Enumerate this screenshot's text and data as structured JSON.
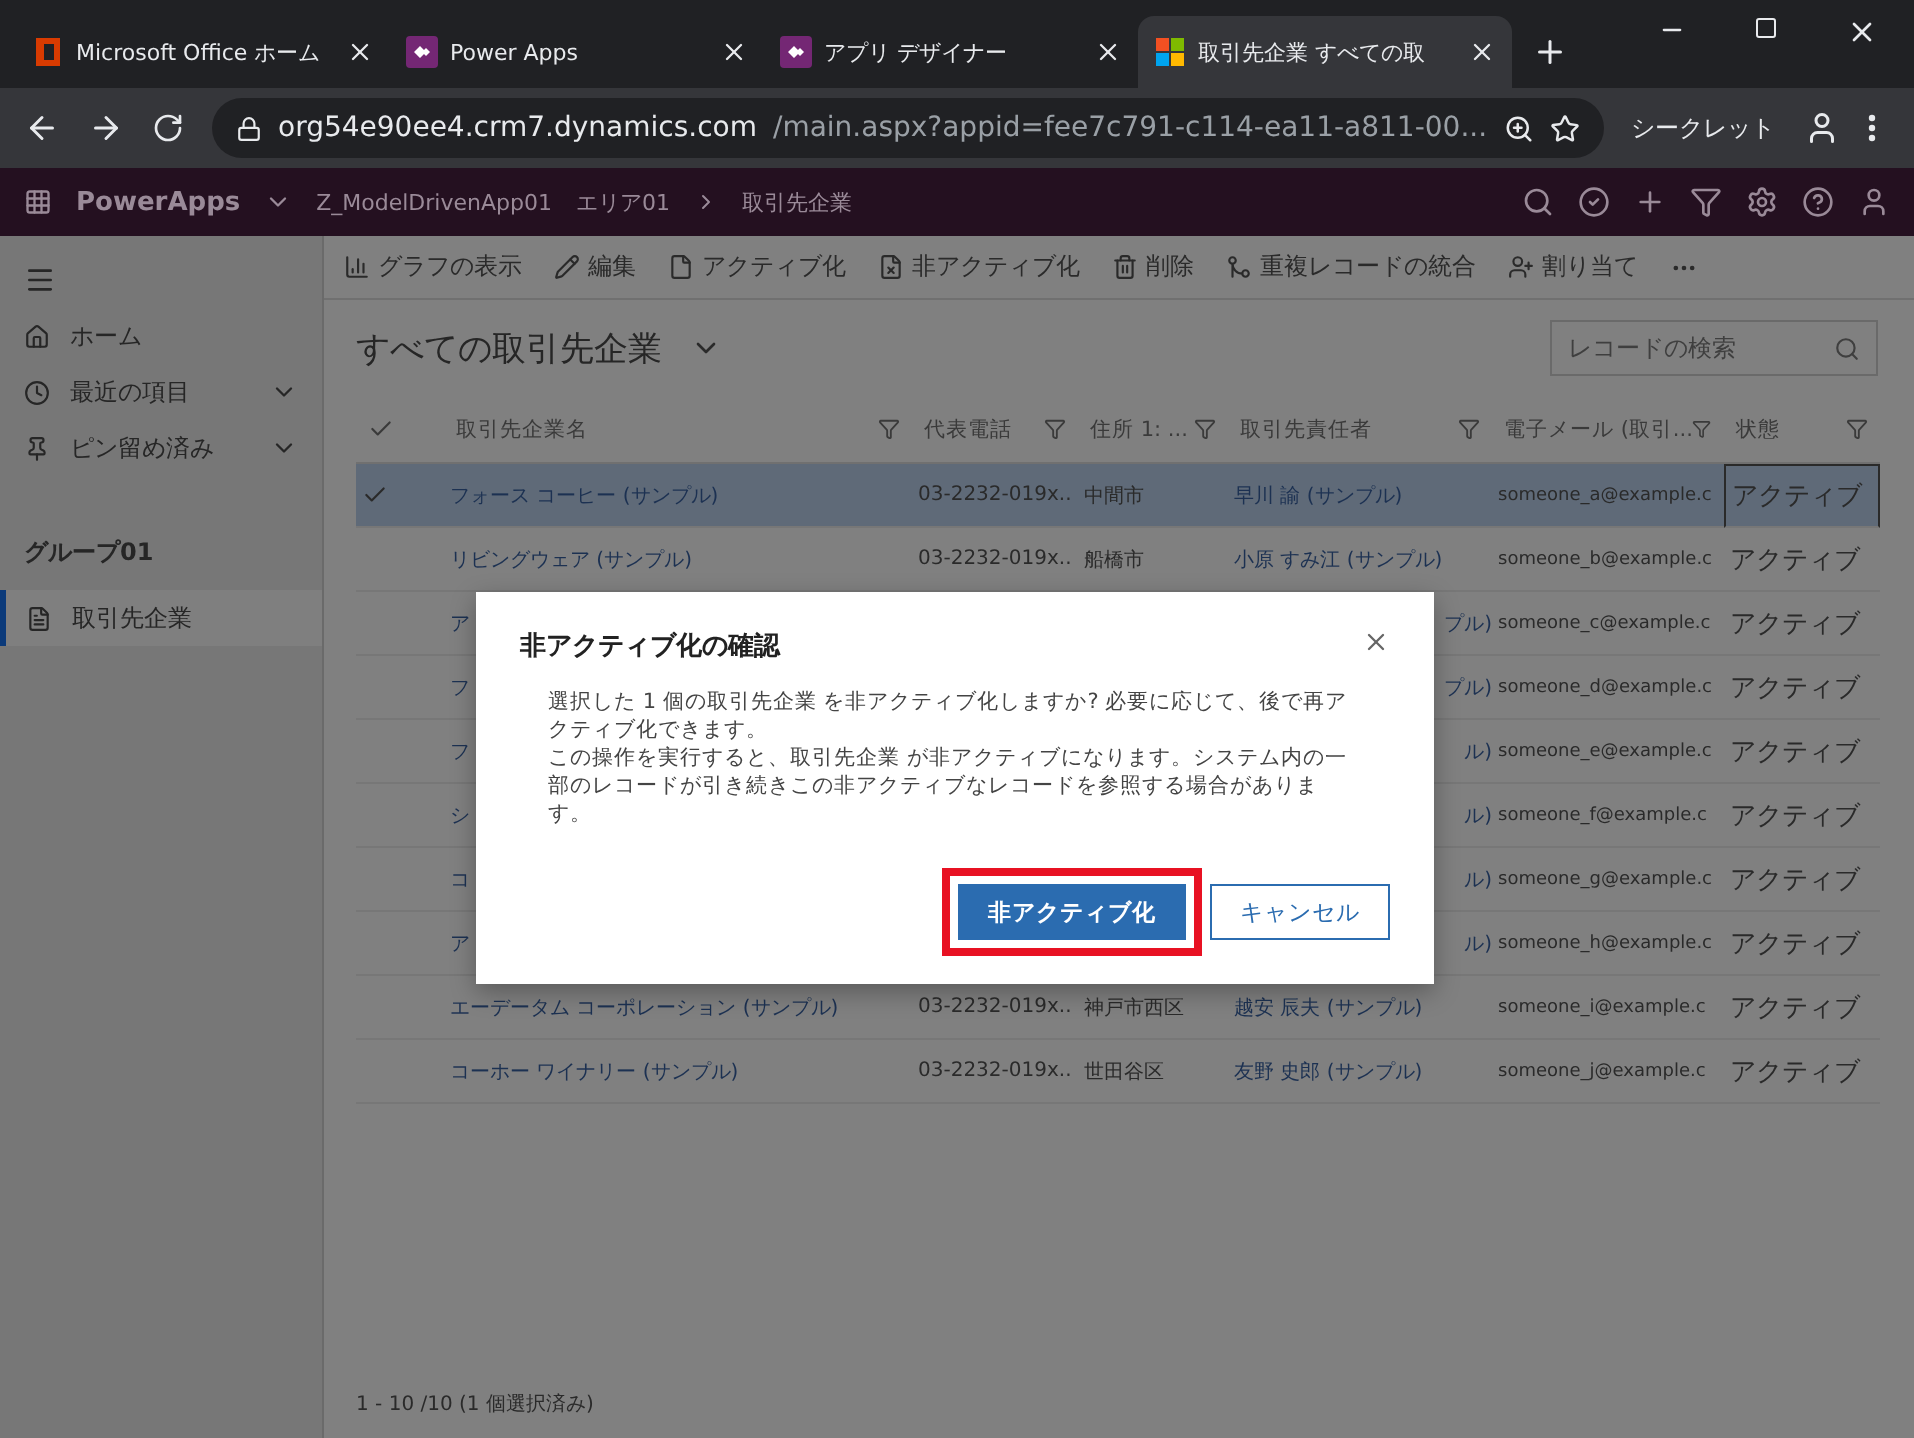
{
  "browser": {
    "tabs": [
      {
        "kind": "office",
        "label": "Microsoft Office ホーム",
        "selected": false
      },
      {
        "kind": "powerapps",
        "label": "Power Apps",
        "selected": false
      },
      {
        "kind": "powerapps",
        "label": "アプリ デザイナー",
        "selected": false
      },
      {
        "kind": "windows",
        "label": "取引先企業 すべての取",
        "selected": true
      }
    ],
    "url_host": "org54e90ee4.crm7.dynamics.com",
    "url_path": "/main.aspx?appid=fee7c791-c114-ea11-a811-00...",
    "profile": "シークレット"
  },
  "header": {
    "brand": "PowerApps",
    "app": "Z_ModelDrivenApp01",
    "breadcrumb": [
      "エリア01",
      "取引先企業"
    ]
  },
  "sidebar": {
    "items": [
      {
        "kind": "home",
        "label": "ホーム"
      },
      {
        "kind": "recent",
        "label": "最近の項目"
      },
      {
        "kind": "pinned",
        "label": "ピン留め済み"
      }
    ],
    "group": "グループ01",
    "entities": [
      {
        "label": "取引先企業",
        "selected": true
      }
    ]
  },
  "commands": [
    {
      "kind": "chart",
      "label": "グラフの表示"
    },
    {
      "kind": "edit",
      "label": "編集"
    },
    {
      "kind": "activate",
      "label": "アクティブ化"
    },
    {
      "kind": "deactivate",
      "label": "非アクティブ化"
    },
    {
      "kind": "delete",
      "label": "削除"
    },
    {
      "kind": "merge",
      "label": "重複レコードの統合"
    },
    {
      "kind": "assign",
      "label": "割り当て"
    }
  ],
  "view": {
    "title": "すべての取引先企業",
    "search_placeholder": "レコードの検索"
  },
  "table": {
    "columns": [
      "取引先企業名",
      "代表電話",
      "住所 1: ...",
      "取引先責任者",
      "電子メール (取引...",
      "状態"
    ],
    "rows": [
      {
        "selected": true,
        "cells": [
          "フォース コーヒー (サンプル)",
          "03-2232-019x..",
          "中間市",
          "早川 諭 (サンプル)",
          "someone_a@example.c",
          "アクティブ"
        ]
      },
      {
        "selected": false,
        "cells": [
          "リビングウェア (サンプル)",
          "03-2232-019x..",
          "船橋市",
          "小原 すみ江 (サンプル)",
          "someone_b@example.c",
          "アクティブ"
        ]
      },
      {
        "selected": false,
        "cells": [
          "ア",
          null,
          null,
          "プル)",
          "someone_c@example.c",
          "アクティブ"
        ]
      },
      {
        "selected": false,
        "cells": [
          "フ",
          null,
          null,
          "プル)",
          "someone_d@example.c",
          "アクティブ"
        ]
      },
      {
        "selected": false,
        "cells": [
          "フ",
          null,
          null,
          "ル)",
          "someone_e@example.c",
          "アクティブ"
        ]
      },
      {
        "selected": false,
        "cells": [
          "シ",
          null,
          null,
          "ル)",
          "someone_f@example.c",
          "アクティブ"
        ]
      },
      {
        "selected": false,
        "cells": [
          "コ",
          null,
          null,
          "ル)",
          "someone_g@example.c",
          "アクティブ"
        ]
      },
      {
        "selected": false,
        "cells": [
          "ア",
          null,
          null,
          "ル)",
          "someone_h@example.c",
          "アクティブ"
        ]
      },
      {
        "selected": false,
        "cells": [
          "エーデータム コーポレーション (サンプル)",
          "03-2232-019x..",
          "神戸市西区",
          "越安 辰夫 (サンプル)",
          "someone_i@example.c",
          "アクティブ"
        ]
      },
      {
        "selected": false,
        "cells": [
          "コーホー ワイナリー (サンプル)",
          "03-2232-019x..",
          "世田谷区",
          "友野 史郎 (サンプル)",
          "someone_j@example.c",
          "アクティブ"
        ]
      }
    ],
    "footer": "1 - 10 /10 (1 個選択済み)"
  },
  "dialog": {
    "title": "非アクティブ化の確認",
    "paragraphs": [
      "選択した 1 個の取引先企業 を非アクティブ化しますか? 必要に応じて、後で再アクティブ化できます。",
      "この操作を実行すると、取引先企業 が非アクティブになります。システム内の一部のレコードが引き続きこの非アクティブなレコードを参照する場合があります。"
    ],
    "buttons": [
      {
        "kind": "primary",
        "label": "非アクティブ化",
        "highlighted": true
      },
      {
        "kind": "secondary",
        "label": "キャンセル",
        "highlighted": false
      }
    ]
  }
}
